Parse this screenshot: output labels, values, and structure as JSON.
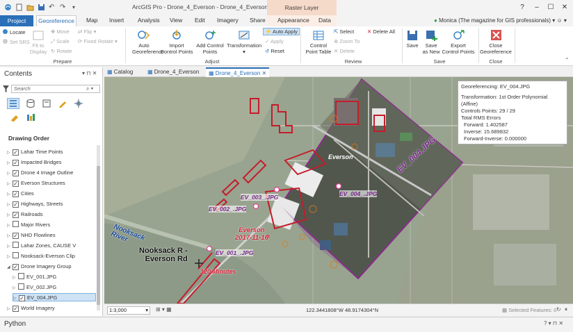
{
  "title_bar": {
    "title": "ArcGIS Pro - Drone_4_Everson - Drone_4_Everson",
    "contextual_tab_group": "Raster Layer"
  },
  "tabs": {
    "project": "Project",
    "georeference": "Georeference",
    "map": "Map",
    "insert": "Insert",
    "analysis": "Analysis",
    "view": "View",
    "edit": "Edit",
    "imagery": "Imagery",
    "share": "Share",
    "appearance": "Appearance",
    "data": "Data"
  },
  "user": "Monica (The magazine for GIS professionals)",
  "ribbon": {
    "prepare": {
      "label": "Prepare",
      "locate": "Locate",
      "set_srs": "Set SRS",
      "fit_to_display_1": "Fit to",
      "fit_to_display_2": "Display",
      "move": "Move",
      "scale": "Scale",
      "rotate": "Rotate",
      "flip": "Flip",
      "fixed_rotate": "Fixed Rotate"
    },
    "adjust": {
      "label": "Adjust",
      "auto_georeference_1": "Auto",
      "auto_georeference_2": "Georeference",
      "import_cp_1": "Import",
      "import_cp_2": "Control Points",
      "add_cp_1": "Add Control",
      "add_cp_2": "Points",
      "transformation": "Transformation",
      "auto_apply": "Auto Apply",
      "apply": "Apply",
      "reset": "Reset"
    },
    "review": {
      "label": "Review",
      "cp_table_1": "Control",
      "cp_table_2": "Point Table",
      "select": "Select",
      "zoom_to": "Zoom To",
      "delete": "Delete",
      "delete_all": "Delete All"
    },
    "save": {
      "label": "Save",
      "save": "Save",
      "save_as_new_1": "Save",
      "save_as_new_2": "as New",
      "export_cp_1": "Export",
      "export_cp_2": "Control Points"
    },
    "close": {
      "label": "Close",
      "close_georef_1": "Close",
      "close_georef_2": "Georeference"
    }
  },
  "contents": {
    "title": "Contents",
    "search_placeholder": "Search",
    "drawing_order": "Drawing Order",
    "layers": [
      {
        "name": "Lahar Time Points",
        "checked": true
      },
      {
        "name": "Impacted Bridges",
        "checked": true
      },
      {
        "name": "Drone 4 Image Outline",
        "checked": true
      },
      {
        "name": "Everson Structures",
        "checked": true
      },
      {
        "name": "Cities",
        "checked": true
      },
      {
        "name": "Highways, Streets",
        "checked": true
      },
      {
        "name": "Railroads",
        "checked": true
      },
      {
        "name": "Major Rivers",
        "checked": false
      },
      {
        "name": "NHD Flowlines",
        "checked": true
      },
      {
        "name": "Lahar Zones, CAUSE V",
        "checked": false
      },
      {
        "name": "Nooksack-Everson Clip",
        "checked": false
      },
      {
        "name": "Drone Imagery Group",
        "checked": true
      },
      {
        "name": "EV_001.JPG",
        "checked": false
      },
      {
        "name": "EV_002.JPG",
        "checked": false
      },
      {
        "name": "EV_004.JPG",
        "checked": true
      },
      {
        "name": "World Imagery",
        "checked": true
      }
    ]
  },
  "map_tabs": {
    "catalog": "Catalog",
    "map1": "Drone_4_Everson",
    "map2": "Drone_4_Everson"
  },
  "map_labels": {
    "everson": "Everson",
    "ev004_diag": "EV_004.JPG",
    "ev004": "EV_004_.JPG",
    "ev003": "EV_003_.JPG",
    "ev002": "EV_002_.JPG",
    "ev001": "EV_001_.JPG",
    "everson_date_1": "Everson",
    "everson_date_2": "2017-11-16",
    "nooksack_river_1": "Nooksack",
    "nooksack_river_2": "River",
    "nooksack_rd_1": "Nooksack R -",
    "nooksack_rd_2": "Everson Rd",
    "minutes": "120 Minutes"
  },
  "georef_info": {
    "title": "Georeferencing: EV_004.JPG",
    "transformation": "Transformation: 1st Order Polynomial (Affine)",
    "control_points": "Controls Points: 29 / 29",
    "rms_title": "Total RMS Errors",
    "forward": "Forward: 1.402587",
    "inverse": "Inverse: 15.689832",
    "forward_inverse": "Forward-Inverse: 0.000000"
  },
  "status": {
    "scale": "1:3,000",
    "coords": "122.3441808°W 48.9174304°N",
    "selected": "Selected Features: 0"
  },
  "python": "Python"
}
